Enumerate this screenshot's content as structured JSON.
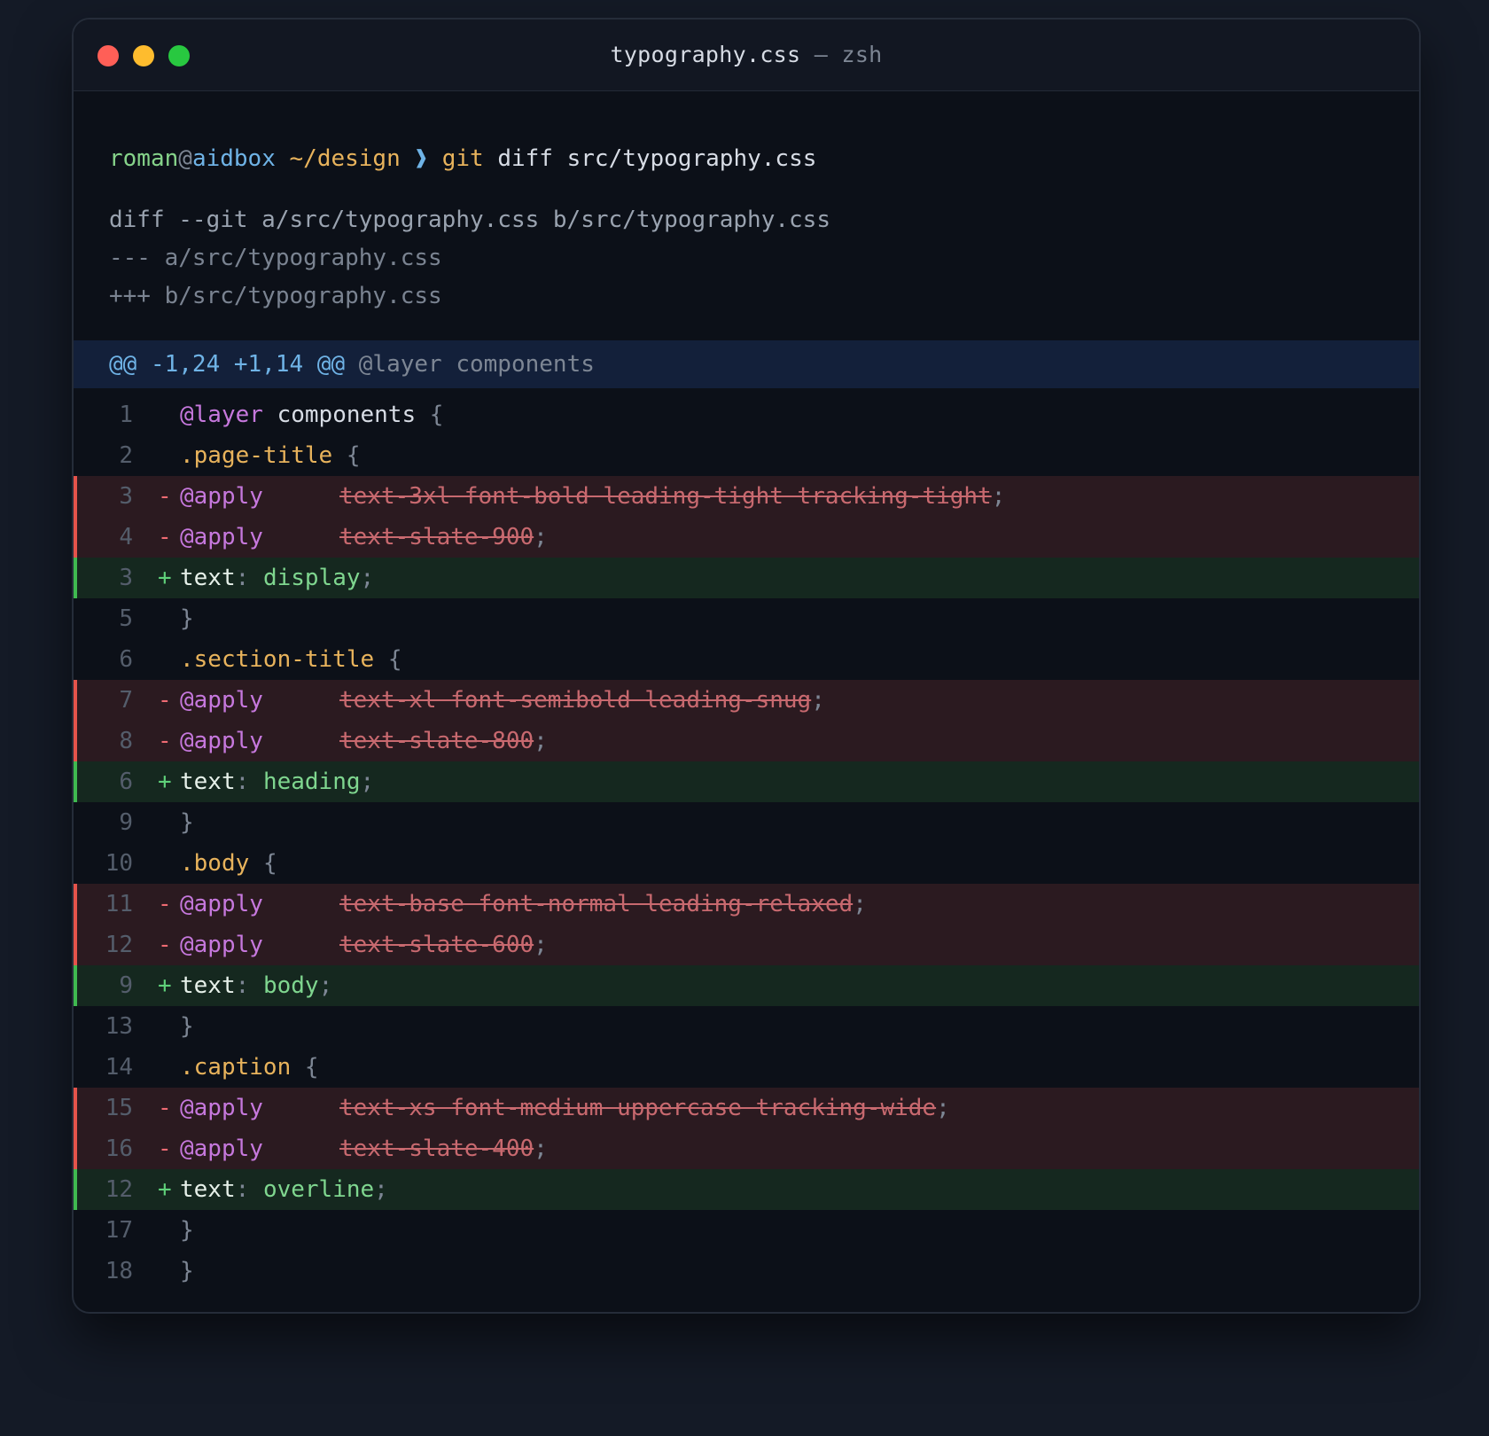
{
  "window": {
    "title_file": "typography.css",
    "title_sep": "—",
    "title_shell": "zsh"
  },
  "prompt": {
    "user": "roman",
    "at": "@",
    "host": "aidbox",
    "dir": "~/design",
    "arrow": "❱",
    "command": "git",
    "args": "diff src/typography.css"
  },
  "diff_header": {
    "line1": "diff --git a/src/typography.css b/src/typography.css",
    "line2": "--- a/src/typography.css",
    "line3": "+++ b/src/typography.css"
  },
  "hunk": {
    "range": "@@ -1,24 +1,14 @@",
    "context": "@layer components"
  },
  "lines": [
    {
      "type": "ctx",
      "ln": "1",
      "kind": "layer",
      "at": "@layer",
      "name": "components",
      "brace": "{"
    },
    {
      "type": "ctx",
      "ln": "2",
      "kind": "selector",
      "selector": ".page-title",
      "brace": "{"
    },
    {
      "type": "del",
      "ln": "3",
      "kind": "apply",
      "at": "@apply",
      "value": "text-3xl font-bold leading-tight tracking-tight",
      "semi": ";"
    },
    {
      "type": "del",
      "ln": "4",
      "kind": "apply",
      "at": "@apply",
      "value": "text-slate-900",
      "semi": ";"
    },
    {
      "type": "add",
      "ln": "3",
      "kind": "prop",
      "prop": "text",
      "colon": ":",
      "value": "display",
      "semi": ";"
    },
    {
      "type": "ctx",
      "ln": "5",
      "kind": "close",
      "brace": "}"
    },
    {
      "type": "ctx",
      "ln": "6",
      "kind": "selector",
      "selector": ".section-title",
      "brace": "{"
    },
    {
      "type": "del",
      "ln": "7",
      "kind": "apply",
      "at": "@apply",
      "value": "text-xl font-semibold leading-snug",
      "semi": ";"
    },
    {
      "type": "del",
      "ln": "8",
      "kind": "apply",
      "at": "@apply",
      "value": "text-slate-800",
      "semi": ";"
    },
    {
      "type": "add",
      "ln": "6",
      "kind": "prop",
      "prop": "text",
      "colon": ":",
      "value": "heading",
      "semi": ";"
    },
    {
      "type": "ctx",
      "ln": "9",
      "kind": "close",
      "brace": "}"
    },
    {
      "type": "ctx",
      "ln": "10",
      "kind": "selector",
      "selector": ".body",
      "brace": "{"
    },
    {
      "type": "del",
      "ln": "11",
      "kind": "apply",
      "at": "@apply",
      "value": "text-base font-normal leading-relaxed",
      "semi": ";"
    },
    {
      "type": "del",
      "ln": "12",
      "kind": "apply",
      "at": "@apply",
      "value": "text-slate-600",
      "semi": ";"
    },
    {
      "type": "add",
      "ln": "9",
      "kind": "prop",
      "prop": "text",
      "colon": ":",
      "value": "body",
      "semi": ";"
    },
    {
      "type": "ctx",
      "ln": "13",
      "kind": "close",
      "brace": "}"
    },
    {
      "type": "ctx",
      "ln": "14",
      "kind": "selector",
      "selector": ".caption",
      "brace": "{"
    },
    {
      "type": "del",
      "ln": "15",
      "kind": "apply",
      "at": "@apply",
      "value": "text-xs font-medium uppercase tracking-wide",
      "semi": ";"
    },
    {
      "type": "del",
      "ln": "16",
      "kind": "apply",
      "at": "@apply",
      "value": "text-slate-400",
      "semi": ";"
    },
    {
      "type": "add",
      "ln": "12",
      "kind": "prop",
      "prop": "text",
      "colon": ":",
      "value": "overline",
      "semi": ";"
    },
    {
      "type": "ctx",
      "ln": "17",
      "kind": "close",
      "brace": "}"
    },
    {
      "type": "ctx",
      "ln": "18",
      "kind": "close",
      "brace": "}"
    }
  ],
  "signs": {
    "del": "-",
    "add": "+"
  },
  "colors": {
    "background": "#141a26",
    "window": "#0c1018",
    "deleted_row": "#2b1a20",
    "added_row": "#15281f",
    "hunk_row": "#13203a",
    "deleted_marker": "#e5534b",
    "added_marker": "#3fb950",
    "traffic_close": "#ff5f57",
    "traffic_minimize": "#febc2e",
    "traffic_zoom": "#28c840"
  }
}
